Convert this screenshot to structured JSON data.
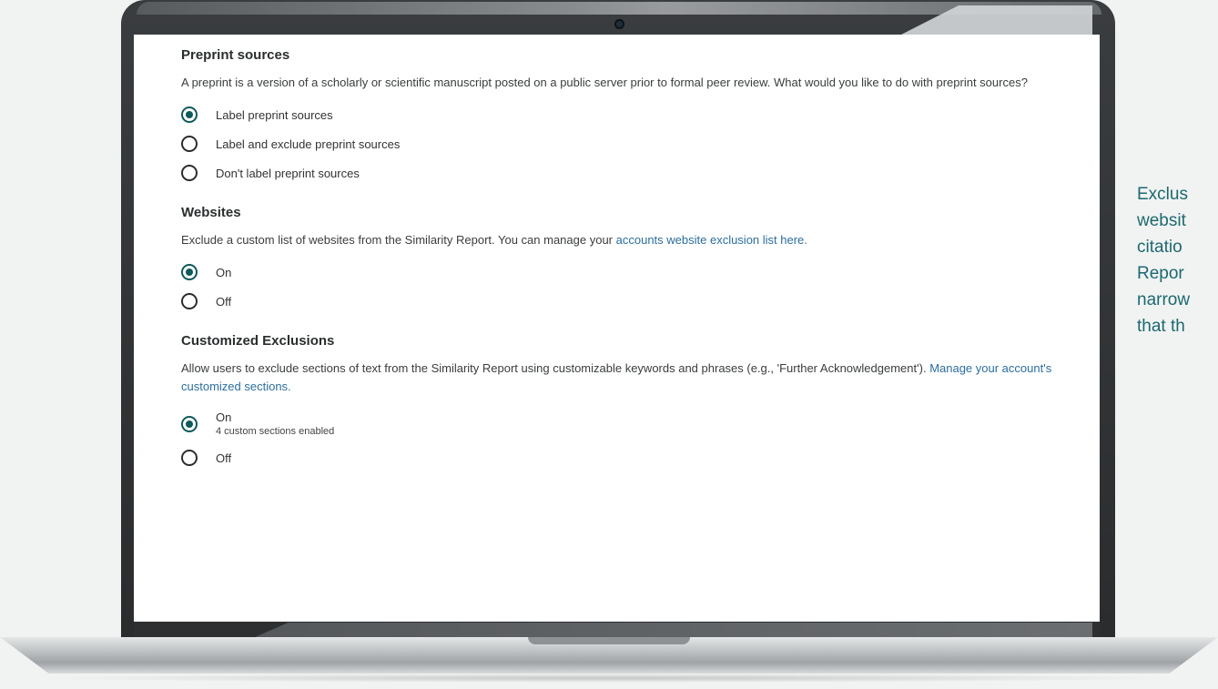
{
  "preprint": {
    "title": "Preprint sources",
    "description": "A preprint is a version of a scholarly or scientific manuscript posted on a public server prior to formal peer review. What would you like to do with preprint sources?",
    "options": [
      {
        "label": "Label preprint sources",
        "checked": true
      },
      {
        "label": "Label and exclude preprint sources",
        "checked": false
      },
      {
        "label": "Don't label preprint sources",
        "checked": false
      }
    ]
  },
  "websites": {
    "title": "Websites",
    "description": "Exclude a custom list of websites from the Similarity Report. You can manage your",
    "link": "accounts website exclusion list here.",
    "options": [
      {
        "label": "On",
        "checked": true
      },
      {
        "label": "Off",
        "checked": false
      }
    ]
  },
  "custom_exclusions": {
    "title": "Customized Exclusions",
    "description": "Allow users to exclude sections of text from the Similarity Report using customizable keywords and phrases (e.g., 'Further Acknowledgement').",
    "link": "Manage your account's customized sections.",
    "options": [
      {
        "label": "On",
        "sublabel": "4 custom sections enabled",
        "checked": true
      },
      {
        "label": "Off",
        "checked": false
      }
    ]
  },
  "side_caption": {
    "lines": [
      "Exclus",
      "websit",
      "citatio",
      "Repor",
      "narrow",
      "that th"
    ]
  },
  "colors": {
    "accent": "#0f5a5a",
    "link": "#2c6e9e",
    "caption": "#1d6870"
  }
}
